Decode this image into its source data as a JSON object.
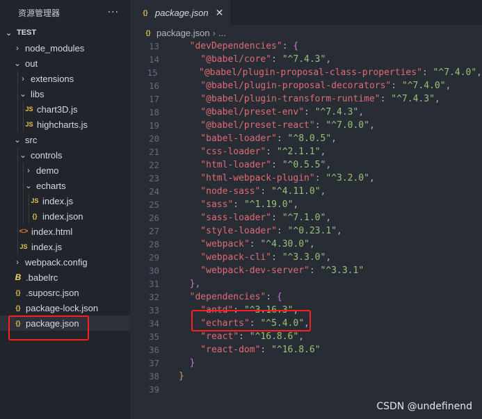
{
  "sidebar": {
    "title": "资源管理器",
    "more_label": "···",
    "folder": "TEST",
    "items": [
      {
        "label": "node_modules",
        "type": "folder",
        "open": false,
        "depth": 1
      },
      {
        "label": "out",
        "type": "folder",
        "open": true,
        "depth": 1
      },
      {
        "label": "extensions",
        "type": "folder",
        "open": false,
        "depth": 2
      },
      {
        "label": "libs",
        "type": "folder",
        "open": true,
        "depth": 2
      },
      {
        "label": "chart3D.js",
        "type": "js",
        "depth": 3
      },
      {
        "label": "highcharts.js",
        "type": "js",
        "depth": 3
      },
      {
        "label": "src",
        "type": "folder",
        "open": true,
        "depth": 1
      },
      {
        "label": "controls",
        "type": "folder",
        "open": true,
        "depth": 2
      },
      {
        "label": "demo",
        "type": "folder",
        "open": false,
        "depth": 3
      },
      {
        "label": "echarts",
        "type": "folder",
        "open": true,
        "depth": 3
      },
      {
        "label": "index.js",
        "type": "js",
        "depth": 4
      },
      {
        "label": "index.json",
        "type": "json",
        "depth": 4
      },
      {
        "label": "index.html",
        "type": "html",
        "depth": 2
      },
      {
        "label": "index.js",
        "type": "js",
        "depth": 2
      },
      {
        "label": "webpack.config",
        "type": "folder",
        "open": false,
        "depth": 1
      },
      {
        "label": ".babelrc",
        "type": "babel",
        "depth": 1
      },
      {
        "label": ".suposrc.json",
        "type": "json",
        "depth": 1
      },
      {
        "label": "package-lock.json",
        "type": "json",
        "depth": 1
      },
      {
        "label": "package.json",
        "type": "json",
        "depth": 1,
        "selected": true
      }
    ]
  },
  "editor": {
    "tab": {
      "label": "package.json",
      "icon": "json-braces-icon"
    },
    "breadcrumb": {
      "file": "package.json",
      "rest": "..."
    },
    "lines": [
      {
        "n": "13",
        "indent": "  ",
        "key": "devDependencies",
        "brace": "{"
      },
      {
        "n": "14",
        "indent": "    ",
        "key": "@babel/core",
        "value": "^7.4.3",
        "comma": true
      },
      {
        "n": "15",
        "indent": "    ",
        "key": "@babel/plugin-proposal-class-properties",
        "value": "^7.4.0",
        "comma": true
      },
      {
        "n": "16",
        "indent": "    ",
        "key": "@babel/plugin-proposal-decorators",
        "value": "^7.4.0",
        "comma": true
      },
      {
        "n": "17",
        "indent": "    ",
        "key": "@babel/plugin-transform-runtime",
        "value": "^7.4.3",
        "comma": true
      },
      {
        "n": "18",
        "indent": "    ",
        "key": "@babel/preset-env",
        "value": "^7.4.3",
        "comma": true
      },
      {
        "n": "19",
        "indent": "    ",
        "key": "@babel/preset-react",
        "value": "^7.0.0",
        "comma": true
      },
      {
        "n": "20",
        "indent": "    ",
        "key": "babel-loader",
        "value": "^8.0.5",
        "comma": true
      },
      {
        "n": "21",
        "indent": "    ",
        "key": "css-loader",
        "value": "^2.1.1",
        "comma": true
      },
      {
        "n": "22",
        "indent": "    ",
        "key": "html-loader",
        "value": "^0.5.5",
        "comma": true
      },
      {
        "n": "23",
        "indent": "    ",
        "key": "html-webpack-plugin",
        "value": "^3.2.0",
        "comma": true
      },
      {
        "n": "24",
        "indent": "    ",
        "key": "node-sass",
        "value": "^4.11.0",
        "comma": true
      },
      {
        "n": "25",
        "indent": "    ",
        "key": "sass",
        "value": "^1.19.0",
        "comma": true
      },
      {
        "n": "26",
        "indent": "    ",
        "key": "sass-loader",
        "value": "^7.1.0",
        "comma": true
      },
      {
        "n": "27",
        "indent": "    ",
        "key": "style-loader",
        "value": "^0.23.1",
        "comma": true
      },
      {
        "n": "28",
        "indent": "    ",
        "key": "webpack",
        "value": "^4.30.0",
        "comma": true
      },
      {
        "n": "29",
        "indent": "    ",
        "key": "webpack-cli",
        "value": "^3.3.0",
        "comma": true
      },
      {
        "n": "30",
        "indent": "    ",
        "key": "webpack-dev-server",
        "value": "^3.3.1"
      },
      {
        "n": "31",
        "indent": "  ",
        "raw": "},"
      },
      {
        "n": "32",
        "indent": "  ",
        "key": "dependencies",
        "brace": "{"
      },
      {
        "n": "33",
        "indent": "    ",
        "key": "antd",
        "value": "^3.16.3",
        "comma": true
      },
      {
        "n": "34",
        "indent": "    ",
        "key": "echarts",
        "value": "^5.4.0",
        "comma": true
      },
      {
        "n": "35",
        "indent": "    ",
        "key": "react",
        "value": "^16.8.6",
        "comma": true
      },
      {
        "n": "36",
        "indent": "    ",
        "key": "react-dom",
        "value": "^16.8.6"
      },
      {
        "n": "37",
        "indent": "  ",
        "raw": "}"
      },
      {
        "n": "38",
        "indent": "",
        "raw": "}"
      },
      {
        "n": "39",
        "indent": "",
        "raw": ""
      }
    ]
  },
  "watermark": "CSDN @undefinend",
  "colors": {
    "highlight": "#ff1f1f",
    "key": "#e06c75",
    "string": "#98c379"
  }
}
